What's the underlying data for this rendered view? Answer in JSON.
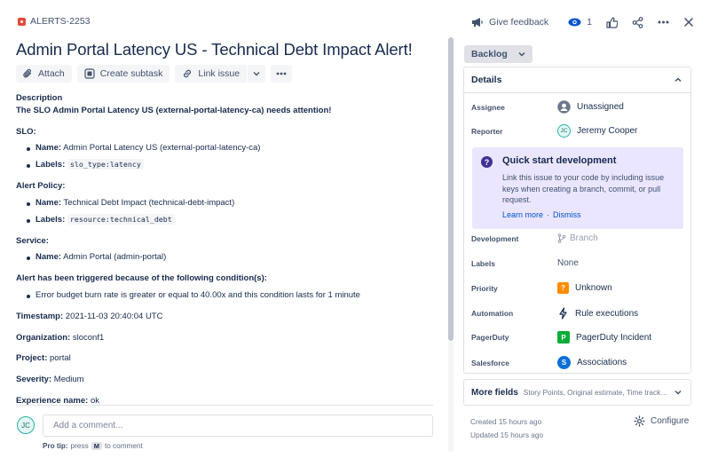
{
  "issue": {
    "key": "ALERTS-2253",
    "title": "Admin Portal Latency US - Technical Debt Impact Alert!"
  },
  "top_actions": {
    "feedback_label": "Give feedback",
    "watch_count": "1"
  },
  "toolbar": {
    "attach_label": "Attach",
    "subtask_label": "Create subtask",
    "link_label": "Link issue"
  },
  "description": {
    "heading": "Description",
    "intro": "The SLO Admin Portal Latency US (external-portal-latency-ca) needs attention!",
    "slo_heading": "SLO:",
    "slo_name_label": "Name:",
    "slo_name": "Admin Portal Latency US (external-portal-latency-ca)",
    "slo_labels_label": "Labels:",
    "slo_labels": "slo_type:latency",
    "policy_heading": "Alert Policy:",
    "policy_name_label": "Name:",
    "policy_name": "Technical Debt Impact (technical-debt-impact)",
    "policy_labels_label": "Labels:",
    "policy_labels": "resource:technical_debt",
    "service_heading": "Service:",
    "service_name_label": "Name:",
    "service_name": "Admin Portal (admin-portal)",
    "condition_heading": "Alert has been triggered because of the following condition(s):",
    "condition": "Error budget burn rate is greater or equal to 40.00x and this condition lasts for 1 minute",
    "timestamp_label": "Timestamp:",
    "timestamp": "2021-11-03 20:40:04 UTC",
    "org_label": "Organization:",
    "org": "sloconf1",
    "project_label": "Project:",
    "project": "portal",
    "severity_label": "Severity:",
    "severity": "Medium",
    "experience_label": "Experience name:",
    "experience": "ok"
  },
  "comment": {
    "avatar_initials": "JC",
    "placeholder": "Add a comment...",
    "pro_tip_label": "Pro tip:",
    "pro_tip_pre": "press",
    "pro_tip_key": "M",
    "pro_tip_post": "to comment"
  },
  "status": {
    "label": "Backlog"
  },
  "details": {
    "heading": "Details",
    "assignee_label": "Assignee",
    "assignee": "Unassigned",
    "reporter_label": "Reporter",
    "reporter": "Jeremy Cooper",
    "reporter_initials": "JC",
    "quick_start": {
      "title": "Quick start development",
      "text": "Link this issue to your code by including issue keys when creating a branch, commit, or pull request.",
      "learn_more": "Learn more",
      "separator": "·",
      "dismiss": "Dismiss"
    },
    "development_label": "Development",
    "development": "Branch",
    "labels_label": "Labels",
    "labels": "None",
    "priority_label": "Priority",
    "priority": "Unknown",
    "automation_label": "Automation",
    "automation": "Rule executions",
    "pagerduty_label": "PagerDuty",
    "pagerduty": "PagerDuty Incident",
    "salesforce_label": "Salesforce",
    "salesforce": "Associations"
  },
  "more_fields": {
    "title": "More fields",
    "subtitle": "Story Points, Original estimate, Time tracking,..."
  },
  "meta": {
    "created": "Created 15 hours ago",
    "updated": "Updated 15 hours ago",
    "configure_label": "Configure"
  },
  "colors": {
    "accent": "#0052cc",
    "bug": "#e5493a",
    "quick_start_bg": "#eae6ff",
    "pagerduty": "#06ac38",
    "salesforce": "#0d6fd8",
    "priority": "#ff8b00"
  }
}
